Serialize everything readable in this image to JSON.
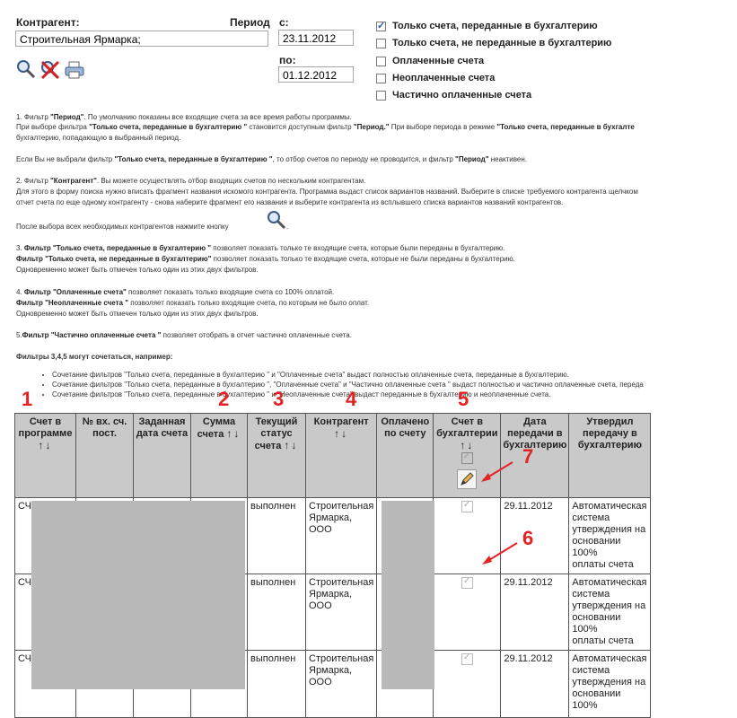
{
  "filters": {
    "kontragent_label": "Контрагент:",
    "kontragent_value": "Строительная Ярмарка;",
    "period_label": "Период",
    "from_label": "с:",
    "from_value": "23.11.2012",
    "to_label": "по:",
    "to_value": "01.12.2012",
    "checkboxes": [
      {
        "label": "Только счета, переданные в бухгалтерию",
        "checked": true
      },
      {
        "label": "Только счета, не переданные в бухгалтерию",
        "checked": false
      },
      {
        "label": "Оплаченные счета",
        "checked": false
      },
      {
        "label": "Неоплаченные счета",
        "checked": false
      },
      {
        "label": "Частично оплаченные счета",
        "checked": false
      }
    ]
  },
  "toolbar_icons": [
    "search-icon",
    "clear-filter-icon",
    "print-icon"
  ],
  "help": {
    "l1a": "1. Фильтр ",
    "l1b": "\"Период\"",
    "l1c": ". По умолчанию показаны все входящие счета за все время работы программы.",
    "l2a": "При выборе фильтра ",
    "l2b": "\"Только счета, переданные в бухгалтерию \"",
    "l2c": " становится доступным фильтр ",
    "l2d": "\"Период.\"",
    "l2e": " При выборе периода в режиме ",
    "l2f": "\"Только счета, переданные в бухгалте",
    "l3": "бухгалтерию, попадающую в выбранный период.",
    "l4a": "Если Вы не выбрали фильтр ",
    "l4b": "\"Только счета, переданные в бухгалтерию \"",
    "l4c": ", то отбор счетов по периоду не проводится, и фильтр ",
    "l4d": "\"Период\"",
    "l4e": " неактивен.",
    "l5a": "2. Фильтр ",
    "l5b": "\"Контрагент\"",
    "l5c": ". Вы можете осуществлять отбор входящих счетов по нескольким контрагентам.",
    "l6": "Для этого в форму поиска нужно вписать фрагмент названия искомого контрагента. Программа выдаст список вариантов названий. Выберите в списке требуемого контрагента щелчком",
    "l7": "отчет счета по еще одному контрагенту - снова наберите фрагмент его названия и выберите контрагента из всплывшего списка вариантов названий контрагентов.",
    "l8": "После выбора всех необходимых контрагентов нажмите кнопку",
    "l8end": ".",
    "l9a": "3. ",
    "l9b": "Фильтр \"Только счета, переданные в бухгалтерию \"",
    "l9c": " позволяет показать только те входящие счета, которые были переданы в бухгалтерию.",
    "l10a": "Фильтр \"Только счета, не переданные в бухгалтерию\"",
    "l10b": " позволяет показать только те входящие счета, которые не были переданы в бухгалтерию.",
    "l11": "Одновременно может быть отмечен только один из этих двух фильтров.",
    "l12a": "4. ",
    "l12b": "Фильтр \"Оплаченные счета\"",
    "l12c": " позволяет показать только входящие счета со 100% оплатой.",
    "l13a": "Фильтр \"Неоплаченные счета \"",
    "l13b": " позволяет показать только входящие счета, по которым не было оплат.",
    "l14": "Одновременно может быть отмечен только один из этих двух фильтров.",
    "l15a": "5.",
    "l15b": "Фильтр \"Частично оплаченные счета \"",
    "l15c": " позволяет отобрать в отчет частично оплаченные счета.",
    "l16": "Фильтры 3,4,5 могут сочетаться, например:",
    "bullets": [
      "Сочетание фильтров \"Только счета, переданные в бухгалтерию \" и \"Оплаченные счета\" выдаст полностью оплаченные счета, переданные в бухгалтерию.",
      "Сочетание фильтров \"Только счета, переданные в бухгалтерию \", \"Оплаченные счета\" и \"Частично оплаченные счета \" выдаст полностью и частично оплаченные счета, переда",
      "Сочетание фильтров \"Только счета, переданные в бухгалтерию \" и \"Неоплаченные счета\" выдаст переданные в бухгалтерию и неоплаченные счета."
    ]
  },
  "table": {
    "headers": [
      {
        "l1": "Счет в",
        "l2": "программе",
        "sort": true
      },
      {
        "l1": "№ вх. сч.",
        "l2": "пост.",
        "sort": false
      },
      {
        "l1": "Заданная",
        "l2": "дата счета",
        "sort": false
      },
      {
        "l1": "Сумма",
        "l2": "счета",
        "sort": true
      },
      {
        "l1": "Текущий",
        "l2": "статус",
        "l3": "счета",
        "sort": true
      },
      {
        "l1": "Контрагент",
        "l2": "",
        "sort": true
      },
      {
        "l1": "Оплачено",
        "l2": "по счету",
        "sort": false
      },
      {
        "l1": "Счет в",
        "l2": "бухгалтерии",
        "sort": true
      },
      {
        "l1": "Дата",
        "l2": "передачи в",
        "l3": "бухгалтерию",
        "sort": false
      },
      {
        "l1": "Утвердил",
        "l2": "передачу в",
        "l3": "бухгалтерию",
        "sort": false
      }
    ],
    "sort_glyph": "↑↓",
    "rows": [
      {
        "c0": "СЧ",
        "status": "выполнен",
        "k1": "Строительная",
        "k2": "Ярмарка,",
        "k3": "ООО",
        "date": "29.11.2012",
        "a1": "Автоматическая",
        "a2": "система",
        "a3": "утверждения на",
        "a4": "основании 100%",
        "a5": "оплаты счета"
      },
      {
        "c0": "СЧ",
        "status": "выполнен",
        "k1": "Строительная",
        "k2": "Ярмарка,",
        "k3": "ООО",
        "date": "29.11.2012",
        "a1": "Автоматическая",
        "a2": "система",
        "a3": "утверждения на",
        "a4": "основании 100%",
        "a5": "оплаты счета"
      },
      {
        "c0": "СЧ",
        "status": "выполнен",
        "k1": "Строительная",
        "k2": "Ярмарка,",
        "k3": "ООО",
        "date": "29.11.2012",
        "a1": "Автоматическая",
        "a2": "система",
        "a3": "утверждения на",
        "a4": "основании 100%",
        "a5": ""
      }
    ]
  },
  "annotations": [
    "1",
    "2",
    "3",
    "4",
    "5",
    "6",
    "7"
  ],
  "annotation_color": "#e32222"
}
